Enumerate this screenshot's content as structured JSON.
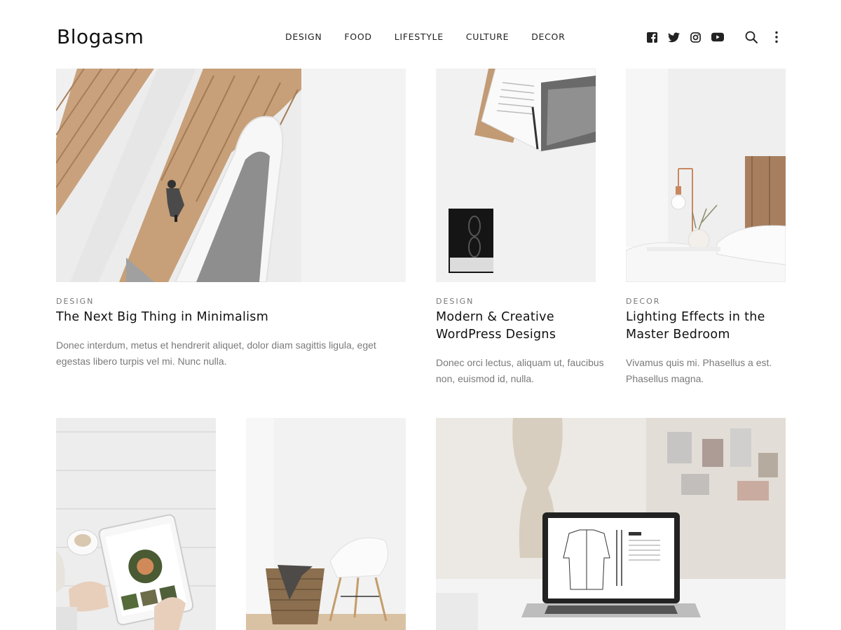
{
  "site": {
    "logo": "Blogasm"
  },
  "nav": [
    {
      "label": "DESIGN"
    },
    {
      "label": "FOOD"
    },
    {
      "label": "LIFESTYLE"
    },
    {
      "label": "CULTURE"
    },
    {
      "label": "DECOR"
    }
  ],
  "header_icons": {
    "social": [
      "facebook-icon",
      "twitter-icon",
      "instagram-icon",
      "youtube-icon"
    ],
    "actions": [
      "search-icon",
      "more-vertical-icon"
    ]
  },
  "posts": [
    {
      "category": "DESIGN",
      "title": "The Next Big Thing in Minimalism",
      "excerpt": "Donec interdum, metus et hendrerit aliquet, dolor diam sagittis ligula, eget egestas libero turpis vel mi. Nunc nulla."
    },
    {
      "category": "DESIGN",
      "title": "Modern & Creative WordPress Designs",
      "excerpt": "Donec orci lectus, aliquam ut, faucibus non, euismod id, nulla."
    },
    {
      "category": "DECOR",
      "title": "Lighting Effects in the Master Bedroom",
      "excerpt": "Vivamus quis mi. Phasellus a est. Phasellus magna."
    }
  ],
  "colors": {
    "text": "#111111",
    "muted": "#7a7a7a",
    "category": "#777777",
    "background": "#ffffff"
  }
}
